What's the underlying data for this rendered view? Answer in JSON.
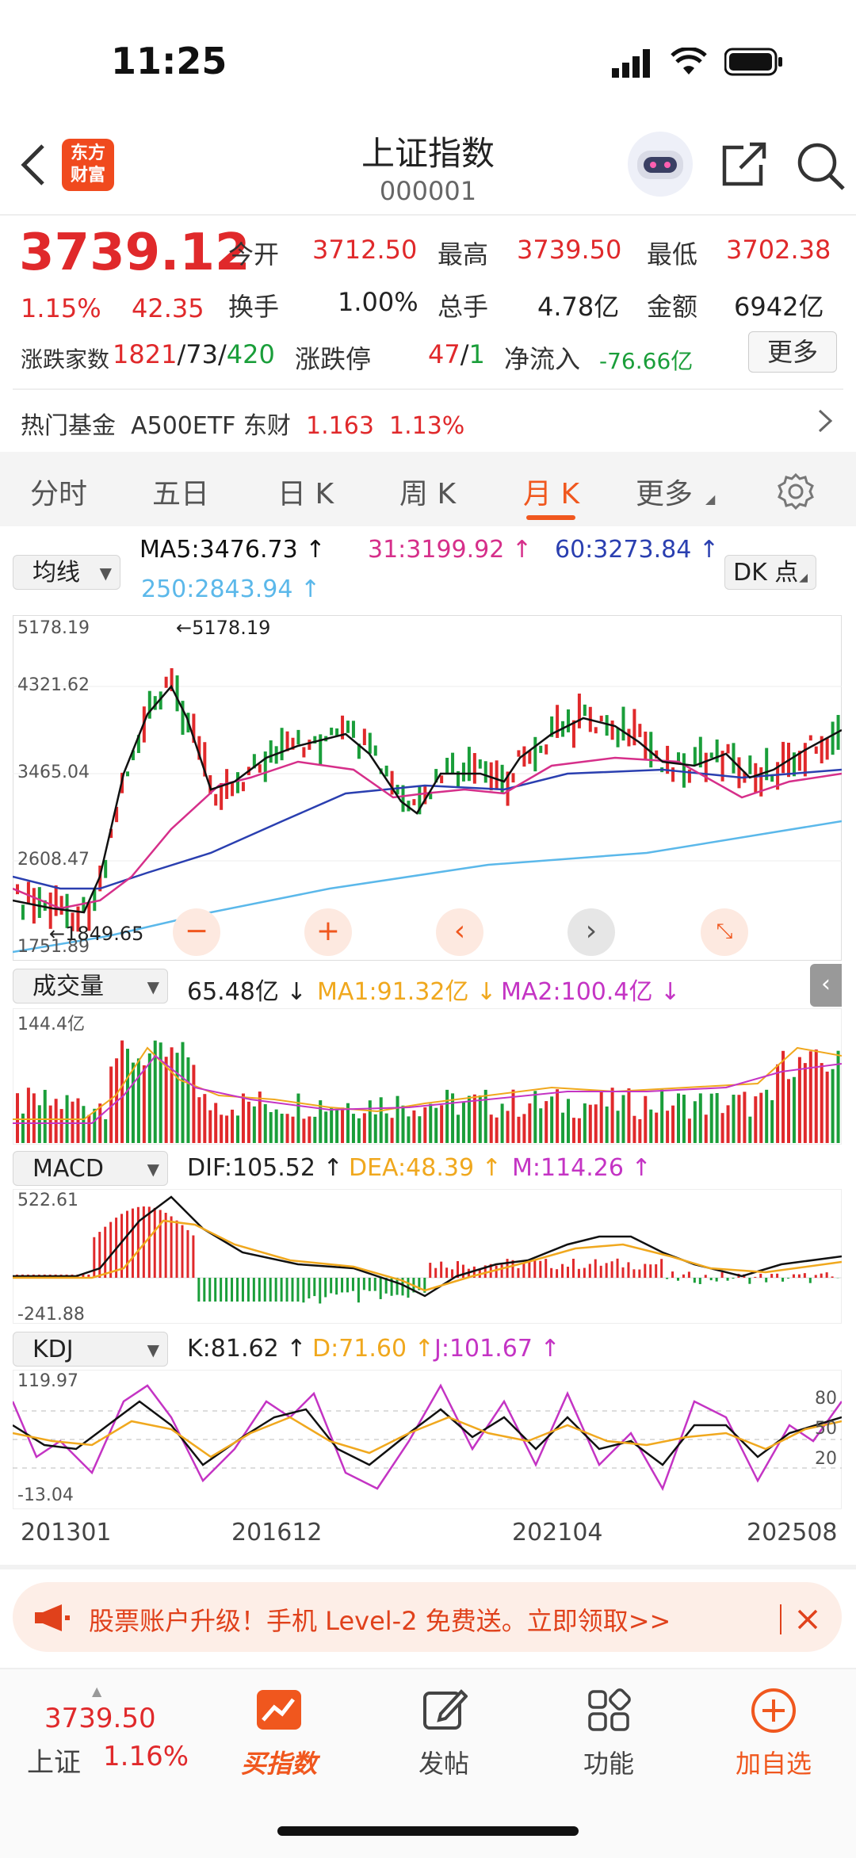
{
  "status": {
    "time": "11:25"
  },
  "header": {
    "title": "上证指数",
    "code": "000001",
    "logo_text_1": "东方",
    "logo_text_2": "财富"
  },
  "quote": {
    "price": "3739.12",
    "change_pct": "1.15%",
    "change": "42.35",
    "open_label": "今开",
    "open": "3712.50",
    "high_label": "最高",
    "high": "3739.50",
    "low_label": "最低",
    "low": "3702.38",
    "turnover_label": "换手",
    "turnover": "1.00%",
    "volume_label": "总手",
    "volume": "4.78亿",
    "amount_label": "金额",
    "amount": "6942亿",
    "breadth_label": "涨跌家数",
    "up": "1821",
    "flat": "73",
    "down": "420",
    "limit_label": "涨跌停",
    "limit_up": "47",
    "limit_down": "1",
    "netflow_label": "净流入",
    "netflow": "-76.66亿",
    "more_button": "更多"
  },
  "hot_fund": {
    "label": "热门基金",
    "name": "A500ETF 东财",
    "price": "1.163",
    "pct": "1.13%"
  },
  "tabs": [
    "分时",
    "五日",
    "日 K",
    "周 K",
    "月 K",
    "更多"
  ],
  "active_tab": "月 K",
  "ma_panel": {
    "selector": "均线",
    "ma5": "MA5:3476.73",
    "ma31": "31:3199.92",
    "ma60": "60:3273.84",
    "ma250": "250:2843.94",
    "dk_button": "DK 点"
  },
  "kline_axis": {
    "top": "5178.19",
    "l2": "4321.62",
    "l3": "3465.04",
    "l4": "2608.47",
    "bottom": "1751.89",
    "max_marker": "5178.19",
    "min_marker": "1849.65"
  },
  "volume_panel": {
    "selector": "成交量",
    "value": "65.48亿",
    "ma1": "MA1:91.32亿",
    "ma2": "MA2:100.4亿",
    "axis_top": "144.4亿"
  },
  "macd_panel": {
    "selector": "MACD",
    "dif": "DIF:105.52",
    "dea": "DEA:48.39",
    "m": "M:114.26",
    "axis_top": "522.61",
    "axis_bottom": "-241.88"
  },
  "kdj_panel": {
    "selector": "KDJ",
    "k": "K:81.62",
    "d": "D:71.60",
    "j": "J:101.67",
    "axis_top": "119.97",
    "axis_bottom": "-13.04",
    "r80": "80",
    "r50": "50",
    "r20": "20"
  },
  "x_axis": [
    "201301",
    "201612",
    "202104",
    "202508"
  ],
  "banner": {
    "text": "股票账户升级！手机 Level-2 免费送。立即领取>>"
  },
  "bottom_nav": {
    "index_price": "3739.50",
    "index_name": "上证",
    "index_pct": "1.16%",
    "items": [
      "买指数",
      "发帖",
      "功能",
      "加自选"
    ]
  },
  "colors": {
    "up": "#e0292b",
    "down": "#1a9e3a",
    "accent": "#f0571e",
    "ma5": "#000000",
    "ma31": "#d62f8a",
    "ma60": "#2a3fb0",
    "ma250": "#5bb8ea"
  }
}
